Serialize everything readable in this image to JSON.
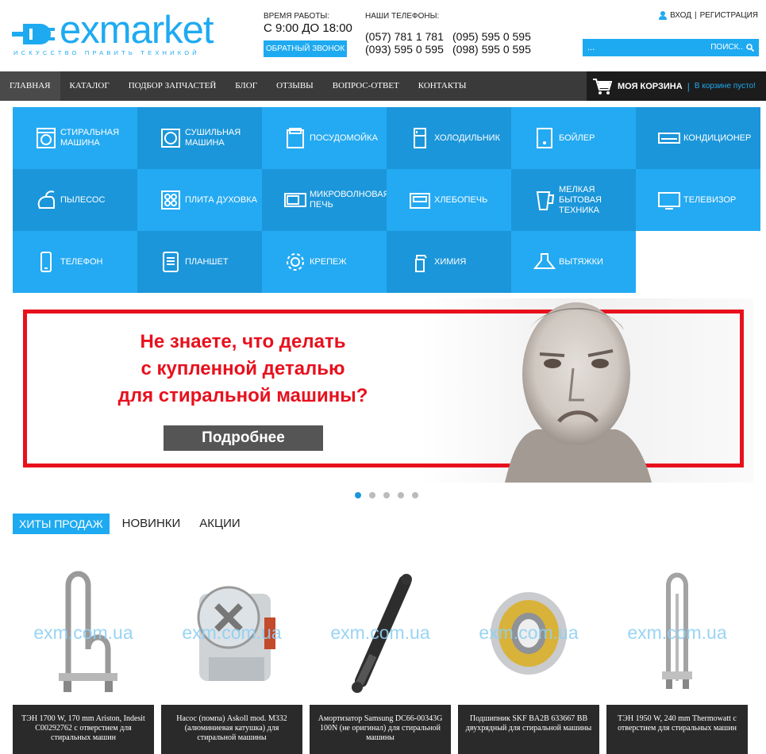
{
  "logo": {
    "name": "exmarket",
    "tagline": "искусство править техникой"
  },
  "hours": {
    "title": "ВРЕМЯ РАБОТЫ:",
    "value": "С 9:00 ДО 18:00",
    "callback": "ОБРАТНЫЙ ЗВОНОК"
  },
  "phones": {
    "title": "НАШИ ТЕЛЕФОНЫ:",
    "list": [
      "(057) 781 1 781",
      "(095) 595 0 595",
      "(093) 595 0 595",
      "(098) 595 0 595"
    ]
  },
  "auth": {
    "login": "ВХОД",
    "sep": "|",
    "register": "РЕГИСТРАЦИЯ"
  },
  "search": {
    "placeholder": "...",
    "button": "ПОИСК.."
  },
  "nav": {
    "items": [
      "ГЛАВНАЯ",
      "КАТАЛОГ",
      "ПОДБОР ЗАПЧАСТЕЙ",
      "БЛОГ",
      "ОТЗЫВЫ",
      "ВОПРОС-ОТВЕТ",
      "КОНТАКТЫ"
    ],
    "active": 0
  },
  "cart": {
    "label": "МОЯ КОРЗИНА",
    "sep": "|",
    "status": "В корзине пусто!"
  },
  "categories": [
    {
      "label": "СТИРАЛЬНАЯ МАШИНА",
      "icon": "washing-machine-icon"
    },
    {
      "label": "СУШИЛЬНАЯ МАШИНА",
      "icon": "dryer-icon"
    },
    {
      "label": "ПОСУДОМОЙКА",
      "icon": "dishwasher-icon"
    },
    {
      "label": "ХОЛОДИЛЬНИК",
      "icon": "fridge-icon"
    },
    {
      "label": "БОЙЛЕР",
      "icon": "boiler-icon"
    },
    {
      "label": "КОНДИЦИОНЕР",
      "icon": "air-conditioner-icon"
    },
    {
      "label": "ПЫЛЕСОС",
      "icon": "vacuum-icon"
    },
    {
      "label": "ПЛИТА ДУХОВКА",
      "icon": "stove-icon"
    },
    {
      "label": "МИКРОВОЛНОВАЯ ПЕЧЬ",
      "icon": "microwave-icon"
    },
    {
      "label": "ХЛЕБОПЕЧЬ",
      "icon": "bread-maker-icon"
    },
    {
      "label": "МЕЛКАЯ БЫТОВАЯ ТЕХНИКА",
      "icon": "small-appliances-icon"
    },
    {
      "label": "ТЕЛЕВИЗОР",
      "icon": "tv-icon"
    },
    {
      "label": "ТЕЛЕФОН",
      "icon": "phone-icon"
    },
    {
      "label": "ПЛАНШЕТ",
      "icon": "tablet-icon"
    },
    {
      "label": "КРЕПЕЖ",
      "icon": "gear-icon"
    },
    {
      "label": "ХИМИЯ",
      "icon": "spray-icon"
    },
    {
      "label": "ВЫТЯЖКИ",
      "icon": "hood-icon"
    }
  ],
  "banner": {
    "line1": "Не знаете, что делать",
    "line2": "с купленной деталью",
    "line3": "для стиральной машины?",
    "button": "Подробнее"
  },
  "slider": {
    "count": 5,
    "active": 0
  },
  "tabs": {
    "items": [
      "ХИТЫ ПРОДАЖ",
      "НОВИНКИ",
      "АКЦИИ"
    ],
    "active": 0
  },
  "watermark": "exm.com.ua",
  "products": [
    {
      "name": "ТЭН 1700 W, 170 mm Ariston, Indesit C00292762 с отверстием для стиральных машин"
    },
    {
      "name": "Насос (помпа) Askoll mod. M332 (алюминиевая катушка) для стиральной машины"
    },
    {
      "name": "Амортизатор Samsung DC66-00343G 100N (не оригинал) для стиральной машины"
    },
    {
      "name": "Подшипник SKF BA2B 633667 BB двухрядный для стиральной машины"
    },
    {
      "name": "ТЭН 1950 W, 240 mm Thermowatt с отверстием для стиральных машин"
    }
  ],
  "colors": {
    "accent": "#1eaaf1",
    "nav": "#3a3a3a",
    "banner_red": "#e8101d"
  }
}
